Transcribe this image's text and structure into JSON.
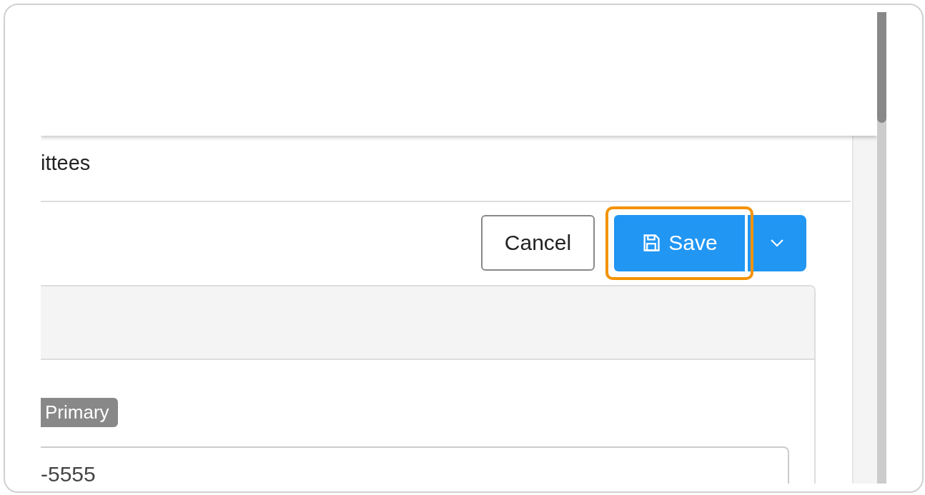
{
  "section": {
    "title": "ittees"
  },
  "actions": {
    "cancel": "Cancel",
    "save": {
      "label": "Save",
      "focused": true
    }
  },
  "badge": {
    "label": "Primary"
  },
  "phone_field": {
    "value": "-5555"
  }
}
